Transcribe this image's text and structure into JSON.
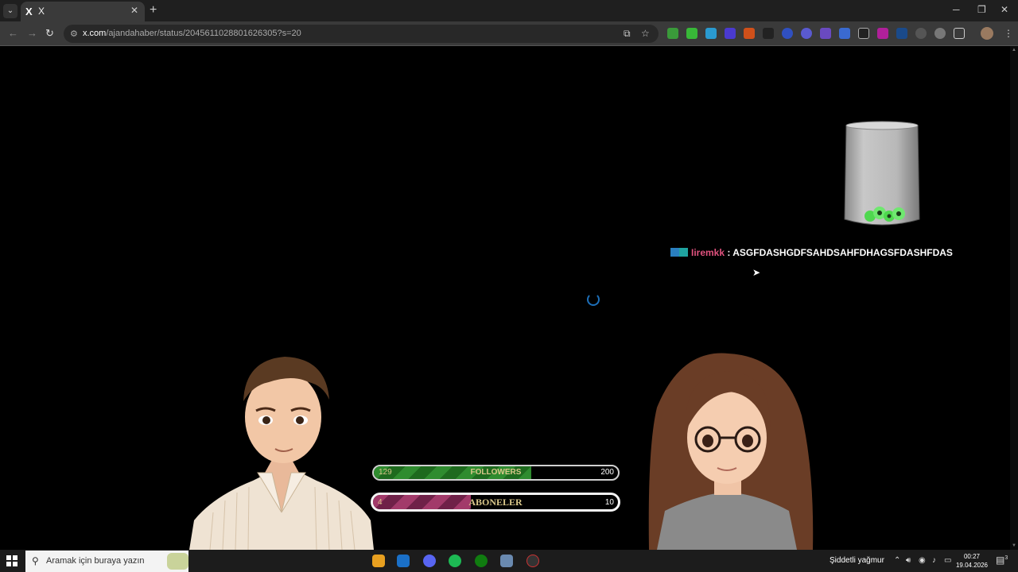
{
  "browser": {
    "tab_title": "X",
    "tab_icon": "X",
    "url_host": "x.com",
    "url_path": "/ajandahaber/status/2045611028801626305?s=20"
  },
  "overlay": {
    "chat": {
      "username": "Iiremkk",
      "separator": ":",
      "message": "ASGFDASHGDFSAHDSAHFDHAGSFDASHFDAS"
    },
    "followers_goal": {
      "label": "FOLLOWERS",
      "current": "129",
      "target": "200",
      "progress": 0.645
    },
    "subscribers_goal": {
      "label": "ABONELER",
      "current": "4",
      "target": "10",
      "progress": 0.4
    }
  },
  "taskbar": {
    "search_placeholder": "Aramak için buraya yazın",
    "weather": "Şiddetli yağmur",
    "time": "00:27",
    "date": "19.04.2026",
    "notification_count": "3"
  },
  "colors": {
    "followers_fill": "#2f8c2f",
    "subscribers_fill": "#a23a6a",
    "chat_username": "#e0527e"
  }
}
